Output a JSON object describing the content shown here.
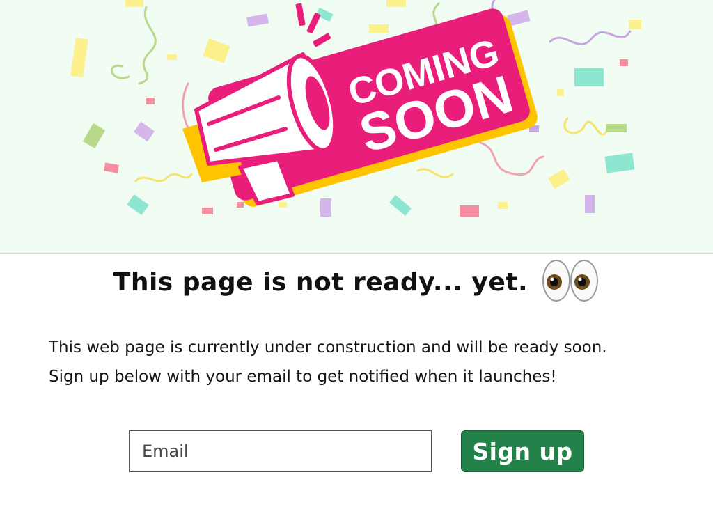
{
  "hero": {
    "banner_line1": "COMING",
    "banner_line2": "SOON",
    "colors": {
      "background": "#f1fcf3",
      "banner": "#e91e7a",
      "banner_shadow": "#ffc400"
    }
  },
  "headline": {
    "text": "This page is not ready... yet.",
    "emoji_icon": "eyes-icon"
  },
  "description": {
    "line1": "This web page is currently under construction and will be ready soon.",
    "line2": "Sign up below with your email to get notified when it launches!"
  },
  "form": {
    "email_placeholder": "Email",
    "email_value": "",
    "signup_label": "Sign up",
    "signup_color": "#23824a"
  }
}
